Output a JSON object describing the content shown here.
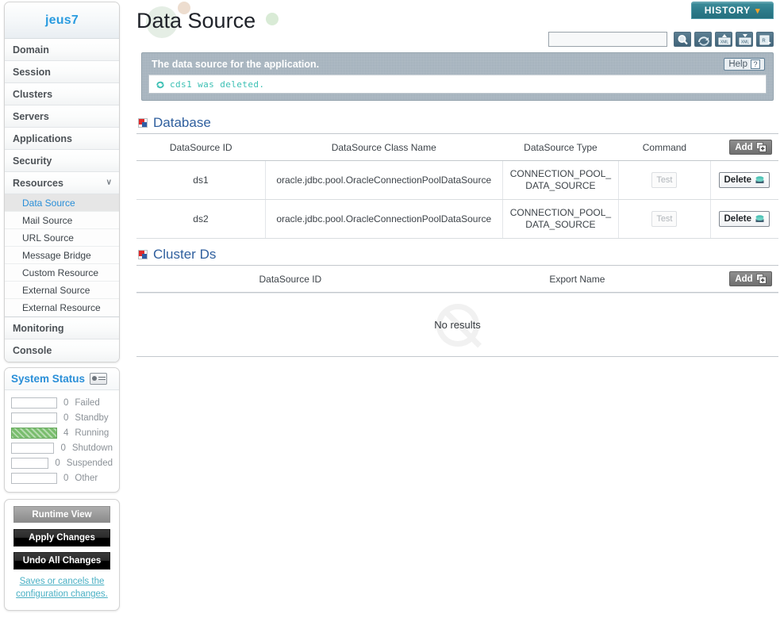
{
  "sidebar": {
    "brand": "jeus7",
    "nav": [
      {
        "label": "Domain",
        "expandable": false
      },
      {
        "label": "Session",
        "expandable": false
      },
      {
        "label": "Clusters",
        "expandable": false
      },
      {
        "label": "Servers",
        "expandable": false
      },
      {
        "label": "Applications",
        "expandable": false
      },
      {
        "label": "Security",
        "expandable": false
      },
      {
        "label": "Resources",
        "expandable": true,
        "chevron": "∨"
      }
    ],
    "sub_items": [
      {
        "label": "Data Source",
        "active": true
      },
      {
        "label": "Mail Source",
        "active": false
      },
      {
        "label": "URL Source",
        "active": false
      },
      {
        "label": "Message Bridge",
        "active": false
      },
      {
        "label": "Custom Resource",
        "active": false
      },
      {
        "label": "External Source",
        "active": false
      },
      {
        "label": "External Resource",
        "active": false
      }
    ],
    "nav_tail": [
      {
        "label": "Monitoring"
      },
      {
        "label": "Console"
      }
    ],
    "system_status": {
      "title": "System Status",
      "icon": "monitor-icon",
      "rows": [
        {
          "count": "0",
          "label": "Failed",
          "state": "empty"
        },
        {
          "count": "0",
          "label": "Standby",
          "state": "empty"
        },
        {
          "count": "4",
          "label": "Running",
          "state": "running"
        },
        {
          "count": "0",
          "label": "Shutdown",
          "state": "empty"
        },
        {
          "count": "0",
          "label": "Suspended",
          "state": "empty"
        },
        {
          "count": "0",
          "label": "Other",
          "state": "empty"
        }
      ]
    },
    "actions": {
      "runtime_view": "Runtime View",
      "apply_changes": "Apply Changes",
      "undo_all_changes": "Undo All Changes",
      "hint": "Saves or cancels the configuration changes."
    }
  },
  "header": {
    "title": "Data Source",
    "history_label": "HISTORY",
    "history_chevron": "▾"
  },
  "toolbar": {
    "search_value": "",
    "search_placeholder": "",
    "icons": [
      "search-icon",
      "refresh-icon",
      "xml-import-icon",
      "xml-export-icon",
      "report-export-icon"
    ]
  },
  "banner": {
    "description": "The data source for the application.",
    "help_label": "Help",
    "help_mark": "?",
    "message": "cds1 was deleted.",
    "message_icon": "refresh-icon"
  },
  "database_section": {
    "title": "Database",
    "add_label": "Add",
    "columns": [
      "DataSource ID",
      "DataSource Class Name",
      "DataSource Type",
      "Command"
    ],
    "rows": [
      {
        "id": "ds1",
        "class_name": "oracle.jdbc.pool.OracleConnectionPoolDataSource",
        "type": "CONNECTION_POOL_\nDATA_SOURCE",
        "command": "Test",
        "action": "Delete"
      },
      {
        "id": "ds2",
        "class_name": "oracle.jdbc.pool.OracleConnectionPoolDataSource",
        "type": "CONNECTION_POOL_\nDATA_SOURCE",
        "command": "Test",
        "action": "Delete"
      }
    ]
  },
  "cluster_section": {
    "title": "Cluster Ds",
    "add_label": "Add",
    "columns": [
      "DataSource ID",
      "Export Name"
    ],
    "empty_text": "No results"
  },
  "colors": {
    "brand_blue": "#2a9ce0",
    "section_title": "#2f5f9e",
    "history_teal": "#2d7c8b",
    "history_chevron_orange": "#f3a32a",
    "message_teal": "#3cc0b4",
    "running_green": "#79bd6d",
    "banner_bg": "#9aa9b5",
    "hint_link": "#4ab0c4"
  }
}
